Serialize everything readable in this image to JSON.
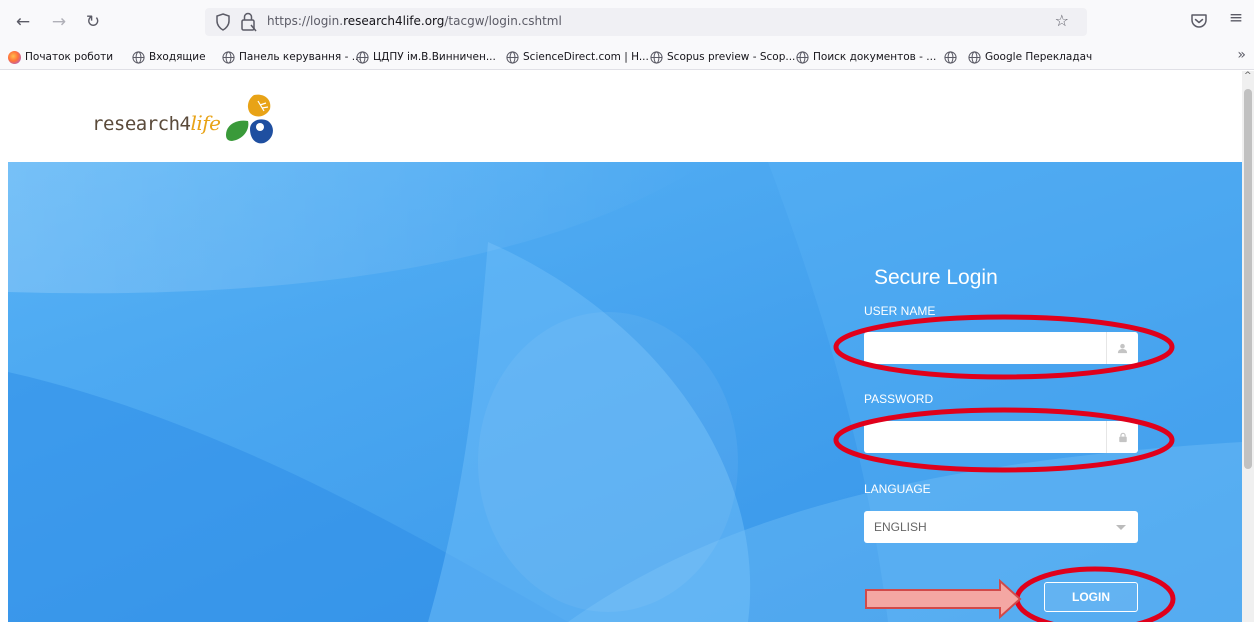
{
  "browser": {
    "url_prefix": "https://login.",
    "url_domain": "research4life.org",
    "url_path": "/tacgw/login.cshtml",
    "bookmarks": [
      {
        "label": "Початок роботи",
        "icon": "firefox-icon"
      },
      {
        "label": "Входящие",
        "icon": "globe-icon"
      },
      {
        "label": "Панель керування - ...",
        "icon": "globe-icon"
      },
      {
        "label": "ЦДПУ ім.В.Винничен...",
        "icon": "globe-icon"
      },
      {
        "label": "ScienceDirect.com | H...",
        "icon": "globe-icon"
      },
      {
        "label": "Scopus preview - Scop...",
        "icon": "globe-icon"
      },
      {
        "label": "Поиск документов - ...",
        "icon": "globe-icon"
      },
      {
        "label": "",
        "icon": "globe-icon"
      },
      {
        "label": "Google Перекладач",
        "icon": "globe-icon"
      }
    ]
  },
  "site": {
    "logo_text_main": "research4",
    "logo_text_accent": "life",
    "logo_colors": {
      "text": "#5a4a3a",
      "accent": "#e8a317",
      "green": "#3a9a3a",
      "blue": "#1f4fa0"
    }
  },
  "login": {
    "title": "Secure Login",
    "username_label": "USER NAME",
    "username_value": "",
    "password_label": "PASSWORD",
    "password_value": "",
    "language_label": "LANGUAGE",
    "language_value": "ENGLISH",
    "button_label": "LOGIN"
  },
  "colors": {
    "hero_blue": "#4aa9f2",
    "annotation_red": "#e0001b",
    "arrow_fill": "#f4a7a3"
  }
}
